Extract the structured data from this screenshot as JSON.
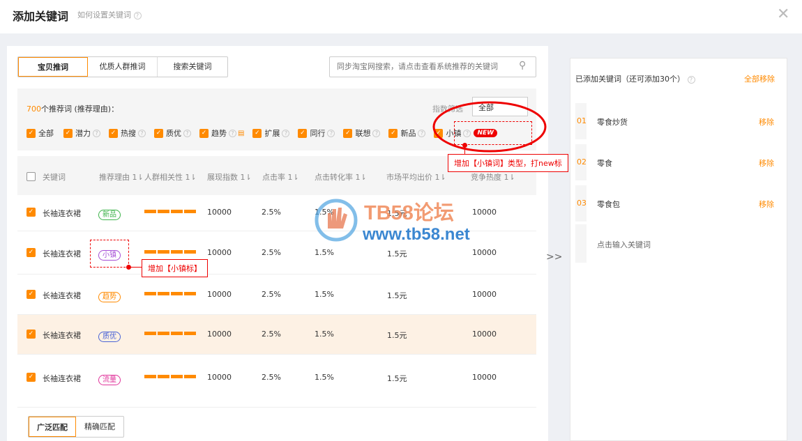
{
  "header": {
    "title": "添加关键词",
    "howto": "如何设置关键词"
  },
  "tabs": [
    "宝贝推词",
    "优质人群推词",
    "搜索关键词"
  ],
  "search": {
    "placeholder": "同步淘宝网搜索，请点击查看系统推荐的关键词"
  },
  "filter": {
    "count_num": "700",
    "count_label": "个推荐词 (推荐理由)：",
    "index_label": "指数筛选",
    "index_value": "全部",
    "checkboxes": [
      "全部",
      "潜力",
      "热搜",
      "质优",
      "趋势",
      "扩展",
      "同行",
      "联想",
      "新品",
      "小镇"
    ],
    "new_badge": "NEW"
  },
  "table": {
    "headers": [
      "关键词",
      "推荐理由 1⇂",
      "人群相关性 1⇂",
      "展现指数 1⇂",
      "点击率 1⇂",
      "点击转化率 1⇂",
      "市场平均出价 1⇂",
      "竞争热度 1⇂"
    ],
    "rows": [
      {
        "keyword": "长袖连衣裙",
        "tag": "新品",
        "tag_color": "#3db34a",
        "impressions": "10000",
        "ctr": "2.5%",
        "cvr": "1.5%",
        "price": "1.5元",
        "heat": "10000"
      },
      {
        "keyword": "长袖连衣裙",
        "tag": "小镇",
        "tag_color": "#a64fd6",
        "impressions": "10000",
        "ctr": "2.5%",
        "cvr": "1.5%",
        "price": "1.5元",
        "heat": "10000"
      },
      {
        "keyword": "长袖连衣裙",
        "tag": "趋势",
        "tag_color": "#ff8a00",
        "impressions": "10000",
        "ctr": "2.5%",
        "cvr": "1.5%",
        "price": "1.5元",
        "heat": "10000"
      },
      {
        "keyword": "长袖连衣裙",
        "tag": "质优",
        "tag_color": "#4a64d6",
        "impressions": "10000",
        "ctr": "2.5%",
        "cvr": "1.5%",
        "price": "1.5元",
        "heat": "10000"
      },
      {
        "keyword": "长袖连衣裙",
        "tag": "流量",
        "tag_color": "#e0349b",
        "impressions": "10000",
        "ctr": "2.5%",
        "cvr": "1.5%",
        "price": "1.5元",
        "heat": "10000"
      }
    ]
  },
  "match": [
    "广泛匹配",
    "精确匹配"
  ],
  "transfer": ">>",
  "right": {
    "title": "已添加关键词（还可添加30个）",
    "remove_all": "全部移除",
    "items": [
      {
        "num": "01",
        "text": "零食炒货",
        "action": "移除"
      },
      {
        "num": "02",
        "text": "零食",
        "action": "移除"
      },
      {
        "num": "03",
        "text": "零食包",
        "action": "移除"
      }
    ],
    "input_placeholder": "点击输入关键词"
  },
  "annotations": {
    "type_note": "增加【小镇词】类型，打new标",
    "tag_note": "增加【小镇标】"
  },
  "watermark": {
    "line1": "TB58论坛",
    "line2": "www.tb58.net"
  },
  "colors": {
    "accent": "#ff8a00",
    "annotation": "#ee0000"
  }
}
